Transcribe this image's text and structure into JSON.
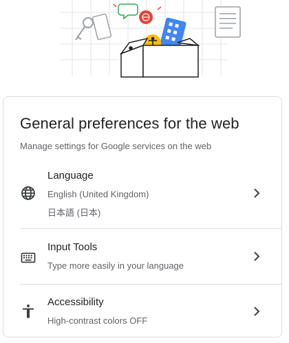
{
  "card": {
    "title": "General preferences for the web",
    "subtitle": "Manage settings for Google services on the web"
  },
  "rows": [
    {
      "title": "Language",
      "lines": [
        "English (United Kingdom)",
        "日本語 (日本)"
      ],
      "icon": "globe-icon"
    },
    {
      "title": "Input Tools",
      "lines": [
        "Type more easily in your language"
      ],
      "icon": "keyboard-icon"
    },
    {
      "title": "Accessibility",
      "lines": [
        "High-contrast colors OFF"
      ],
      "icon": "accessibility-icon"
    }
  ],
  "colors": {
    "text_primary": "#202124",
    "text_secondary": "#5f6368",
    "divider": "#dadce0",
    "illustration_blue": "#4285f4",
    "illustration_red": "#ea4335",
    "illustration_yellow": "#fbbc04",
    "illustration_green": "#34a853"
  }
}
